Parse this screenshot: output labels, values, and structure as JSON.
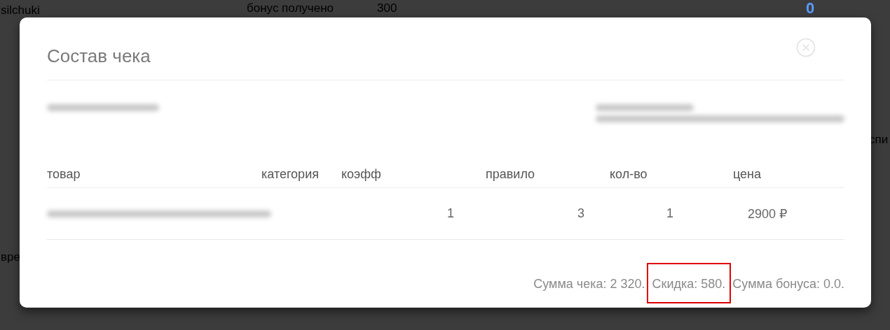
{
  "background": {
    "texts": [
      {
        "kind": "user",
        "text": "silchuki"
      },
      {
        "kind": "label",
        "text": "бонус получено"
      },
      {
        "kind": "amount",
        "text": "300"
      },
      {
        "kind": "counter",
        "text": "0"
      },
      {
        "kind": "side",
        "text": "спи"
      },
      {
        "kind": "left",
        "text": "вре"
      }
    ]
  },
  "dialog": {
    "title": "Состав чека",
    "info": [
      {
        "kind": "redacted_line"
      },
      {
        "kind": "redacted_block"
      }
    ],
    "table": {
      "columns": [
        "товар",
        "категория",
        "коэфф",
        "правило",
        "кол-во",
        "цена"
      ],
      "rows": [
        {
          "product": {
            "kind": "redacted"
          },
          "cells": [
            "",
            "1",
            "3",
            "1",
            "2900 ₽"
          ]
        }
      ]
    },
    "summary": [
      {
        "text": "Сумма чека: 2 320.",
        "highlighted": false
      },
      {
        "text": "Скидка: 580.",
        "highlighted": true
      },
      {
        "text": "Сумма бонуса: 0.0.",
        "highlighted": false
      }
    ]
  }
}
